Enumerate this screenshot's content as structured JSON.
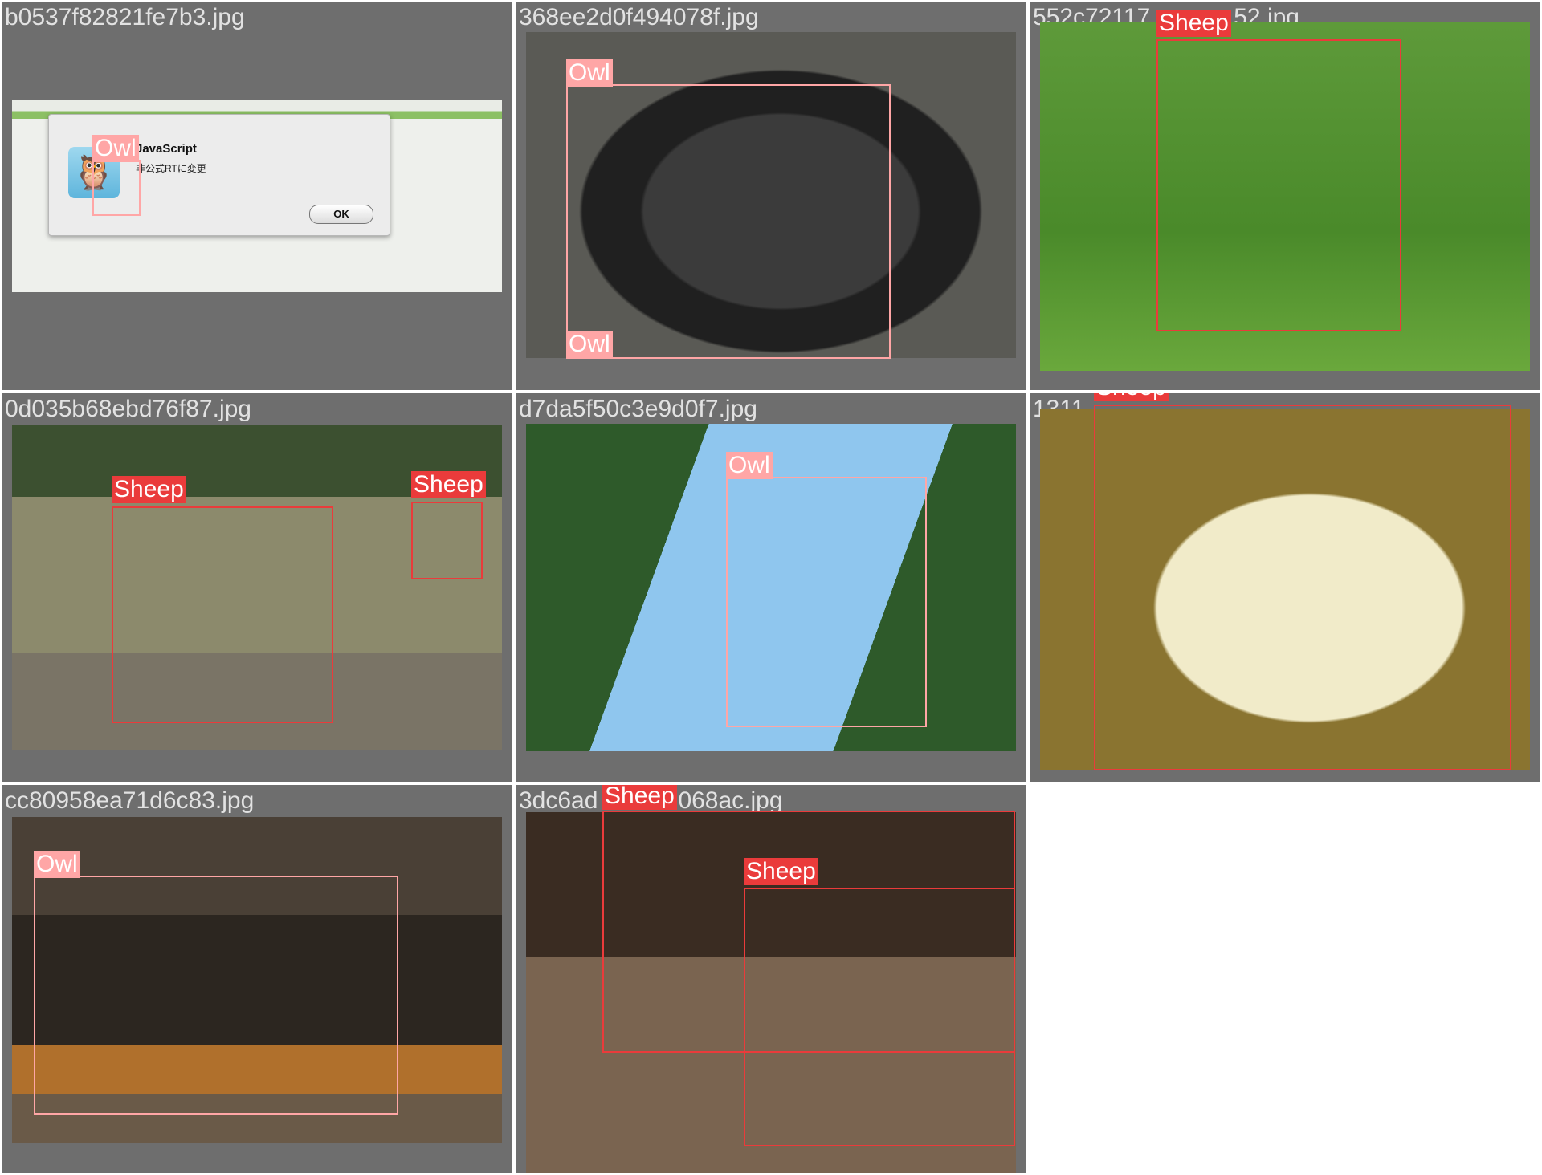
{
  "colors": {
    "owl": "#ffa6a6",
    "sheep": "#ea3b3b",
    "tile_bg": "#6e6e6e",
    "filename_text": "#e2e2e2"
  },
  "tiles": [
    {
      "filename": "b0537f82821fe7b3.jpg",
      "dialog": {
        "title": "JavaScript",
        "message": "非公式RTに変更",
        "ok_label": "OK",
        "icon": "owl-app-icon"
      },
      "detections": [
        {
          "label": "Owl"
        }
      ]
    },
    {
      "filename": "368ee2d0f494078f.jpg",
      "detections": [
        {
          "label": "Owl"
        },
        {
          "label": "Owl"
        }
      ]
    },
    {
      "filename": "552c72117",
      "filename_tail": "52.jpg",
      "detections": [
        {
          "label": "Sheep"
        }
      ]
    },
    {
      "filename": "0d035b68ebd76f87.jpg",
      "detections": [
        {
          "label": "Sheep"
        },
        {
          "label": "Sheep"
        }
      ]
    },
    {
      "filename": "d7da5f50c3e9d0f7.jpg",
      "detections": [
        {
          "label": "Owl"
        }
      ]
    },
    {
      "filename": "1311",
      "detections": [
        {
          "label": "Sheep"
        }
      ]
    },
    {
      "filename": "cc80958ea71d6c83.jpg",
      "detections": [
        {
          "label": "Owl"
        }
      ]
    },
    {
      "filename": "3dc6ad",
      "filename_tail": "068ac.jpg",
      "detections": [
        {
          "label": "Sheep"
        },
        {
          "label": "Sheep"
        }
      ]
    }
  ]
}
